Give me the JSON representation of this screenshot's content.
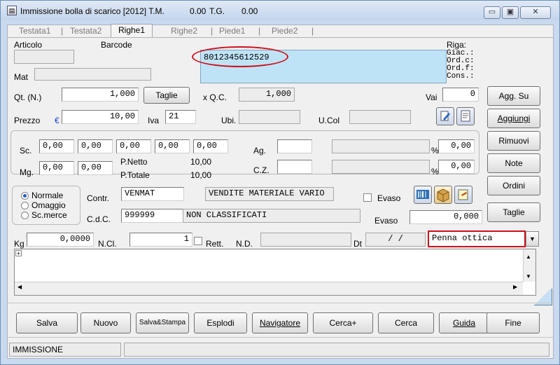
{
  "window": {
    "title": "Immissione bolla di scarico [2012]  T.M.",
    "tm_value": "0.00",
    "tg_label": "T.G.",
    "tg_value": "0.00",
    "controls": {
      "minimize": "▭",
      "maximize": "▣",
      "close": "✕"
    }
  },
  "tabs": [
    {
      "label": "Testata1"
    },
    {
      "label": "Testata2"
    },
    {
      "label": "Righe1"
    },
    {
      "label": "Righe2"
    },
    {
      "label": "Piede1"
    },
    {
      "label": "Piede2"
    }
  ],
  "tab_separators": "|",
  "articolo": {
    "label": "Articolo",
    "barcode_label": "Barcode",
    "value": "",
    "barcode_value": "8012345612529",
    "mat_label": "Mat"
  },
  "riga": {
    "label": "Riga:",
    "lines": [
      "Giac.:",
      "Ord.c:",
      "Ord.f:",
      "Cons.:"
    ]
  },
  "qt": {
    "label": "Qt. (N.)",
    "value": "1,000",
    "taglie_button": "Taglie",
    "qc_label": "x Q.C.",
    "qc_value": "1,000"
  },
  "vai": {
    "label": "Vai",
    "value": "0"
  },
  "prezzo": {
    "label": "Prezzo",
    "currency": "€",
    "value": "10,00",
    "iva_label": "Iva",
    "iva_value": "21",
    "ubi_label": "Ubi.",
    "ucol_label": "U.Col"
  },
  "sc": {
    "label": "Sc.",
    "values": [
      "0,00",
      "0,00",
      "0,00",
      "0,00",
      "0,00"
    ]
  },
  "mg": {
    "label": "Mg.",
    "values": [
      "0,00",
      "0,00"
    ]
  },
  "ag": {
    "label": "Ag.",
    "pct_label": "%",
    "pct_value": "0,00"
  },
  "cz": {
    "label": "C.Z.",
    "pct_label": "%",
    "pct_value": "0,00"
  },
  "totals": {
    "netto_label": "P.Netto",
    "netto_value": "10,00",
    "totale_label": "P.Totale",
    "totale_value": "10,00"
  },
  "tipo": {
    "options": [
      "Normale",
      "Omaggio",
      "Sc.merce"
    ],
    "selected": "Normale"
  },
  "contr": {
    "label": "Contr.",
    "code": "VENMAT",
    "desc": "VENDITE MATERIALE VARIO"
  },
  "cdc": {
    "label": "C.d.C.",
    "code": "999999",
    "desc": "NON CLASSIFICATI"
  },
  "evaso": {
    "check_label": "Evaso",
    "qty_label": "Evaso",
    "qty_value": "0,000"
  },
  "kg": {
    "label": "Kg",
    "value": "0,0000",
    "ncl_label": "N.Cl.",
    "ncl_value": "1",
    "rett_label": "Rett.",
    "nd_label": "N.D.",
    "dt_label": "Dt",
    "dt_value": "/  /"
  },
  "input_mode": {
    "selected": "Penna ottica"
  },
  "side_buttons": [
    "Agg. Su",
    "Aggiungi",
    "Rimuovi",
    "Note",
    "Ordini",
    "Taglie"
  ],
  "bottom_buttons": [
    "Salva",
    "Nuovo",
    "Salva&Stampa",
    "Esplodi",
    "Navigatore",
    "Cerca+",
    "Cerca",
    "Guida",
    "Fine"
  ],
  "status": {
    "mode": "IMMISSIONE",
    "message": ""
  },
  "accent": {
    "highlight_red": "#d0101a",
    "barcode_bg": "#bfe3f6"
  }
}
